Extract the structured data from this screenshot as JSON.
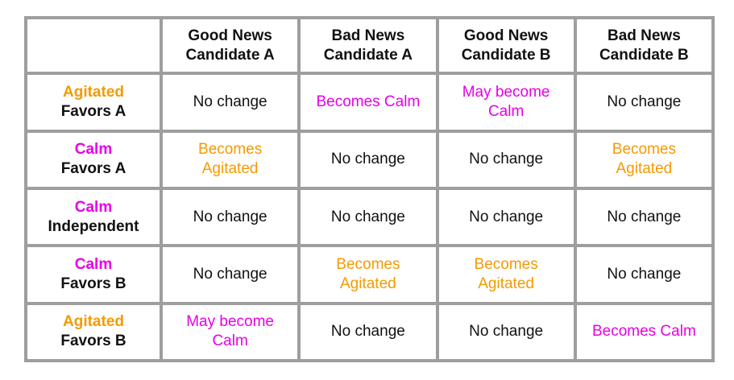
{
  "colors": {
    "agitated": "#f59a00",
    "calm": "#e600e6",
    "text": "#111111",
    "grid": "#9e9e9e"
  },
  "header": [
    {
      "l1": "",
      "l2": ""
    },
    {
      "l1": "Good News",
      "l2": "Candidate A"
    },
    {
      "l1": "Bad News",
      "l2": "Candidate A"
    },
    {
      "l1": "Good News",
      "l2": "Candidate B"
    },
    {
      "l1": "Bad News",
      "l2": "Candidate B"
    }
  ],
  "rows": [
    {
      "state": "Agitated",
      "stance": "Favors A",
      "state_color": "agitated",
      "cells": [
        {
          "l1": "No change",
          "l2": "",
          "color": "text"
        },
        {
          "l1": "Becomes Calm",
          "l2": "",
          "color": "calm"
        },
        {
          "l1": "May become",
          "l2": "Calm",
          "color": "calm"
        },
        {
          "l1": "No change",
          "l2": "",
          "color": "text"
        }
      ]
    },
    {
      "state": "Calm",
      "stance": "Favors A",
      "state_color": "calm",
      "cells": [
        {
          "l1": "Becomes",
          "l2": "Agitated",
          "color": "agitated"
        },
        {
          "l1": "No change",
          "l2": "",
          "color": "text"
        },
        {
          "l1": "No change",
          "l2": "",
          "color": "text"
        },
        {
          "l1": "Becomes",
          "l2": "Agitated",
          "color": "agitated"
        }
      ]
    },
    {
      "state": "Calm",
      "stance": "Independent",
      "state_color": "calm",
      "cells": [
        {
          "l1": "No change",
          "l2": "",
          "color": "text"
        },
        {
          "l1": "No change",
          "l2": "",
          "color": "text"
        },
        {
          "l1": "No change",
          "l2": "",
          "color": "text"
        },
        {
          "l1": "No change",
          "l2": "",
          "color": "text"
        }
      ]
    },
    {
      "state": "Calm",
      "stance": "Favors B",
      "state_color": "calm",
      "cells": [
        {
          "l1": "No change",
          "l2": "",
          "color": "text"
        },
        {
          "l1": "Becomes",
          "l2": "Agitated",
          "color": "agitated"
        },
        {
          "l1": "Becomes",
          "l2": "Agitated",
          "color": "agitated"
        },
        {
          "l1": "No change",
          "l2": "",
          "color": "text"
        }
      ]
    },
    {
      "state": "Agitated",
      "stance": "Favors B",
      "state_color": "agitated",
      "cells": [
        {
          "l1": "May become",
          "l2": "Calm",
          "color": "calm"
        },
        {
          "l1": "No change",
          "l2": "",
          "color": "text"
        },
        {
          "l1": "No change",
          "l2": "",
          "color": "text"
        },
        {
          "l1": "Becomes Calm",
          "l2": "",
          "color": "calm"
        }
      ]
    }
  ]
}
